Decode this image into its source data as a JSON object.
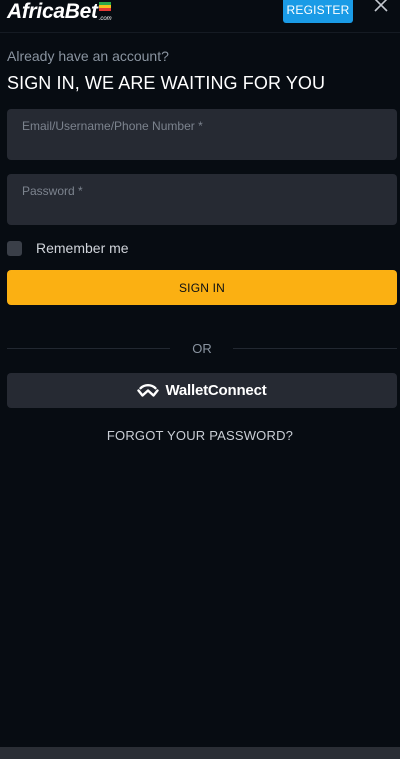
{
  "header": {
    "logo_text": "AfricaBet",
    "logo_suffix": ".com",
    "register_label": "REGISTER",
    "close_icon": "close-icon"
  },
  "login": {
    "subtitle": "Already have an account?",
    "title": "SIGN IN, WE ARE WAITING FOR YOU",
    "email_label": "Email/Username/Phone Number *",
    "email_value": "",
    "password_label": "Password *",
    "password_value": "",
    "remember_label": "Remember me",
    "remember_checked": false,
    "signin_label": "SIGN IN",
    "or_text": "OR",
    "wallet_label": "WalletConnect",
    "wallet_icon": "walletconnect-icon",
    "forgot_label": "FORGOT YOUR PASSWORD?"
  },
  "colors": {
    "background": "#070c12",
    "register": "#1a9be6",
    "signin": "#fbb012",
    "field": "#262a33"
  }
}
